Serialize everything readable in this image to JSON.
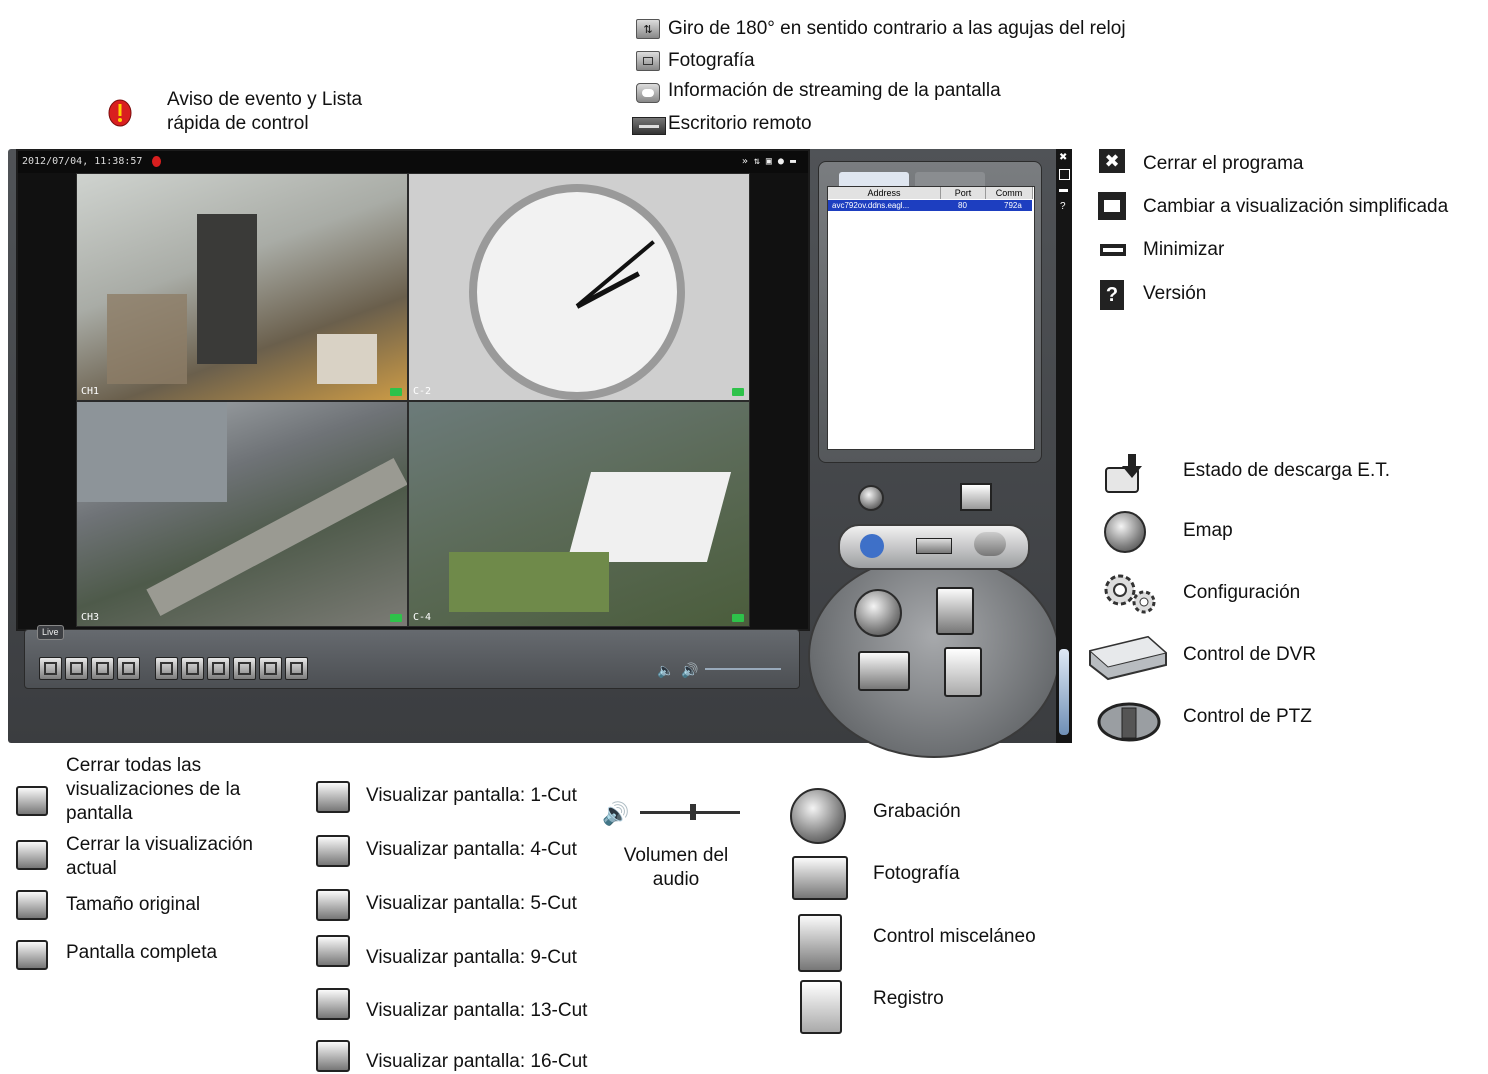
{
  "top_callouts": {
    "event_alert": "Aviso de evento y Lista rápida de control",
    "rotate": "Giro de 180° en sentido contrario a las agujas del reloj",
    "snapshot": "Fotografía",
    "streaming_info": "Información de streaming de la pantalla",
    "remote_desktop": "Escritorio remoto"
  },
  "right_callouts": {
    "close_program": "Cerrar el programa",
    "simple_view": "Cambiar a visualización simplificada",
    "minimize": "Minimizar",
    "version": "Versión",
    "download_status": "Estado de descarga E.T.",
    "emap": "Emap",
    "config": "Configuración",
    "dvr_control": "Control de DVR",
    "ptz_control": "Control de PTZ"
  },
  "app": {
    "timestamp": "2012/07/04, 11:38:57",
    "channels": [
      "CH1",
      "C-2",
      "CH3",
      "C-4"
    ],
    "live_tag": "Live",
    "device_list": {
      "columns": [
        "Address",
        "Port",
        "Comm"
      ],
      "rows": [
        [
          "avc792ov.ddns.eagl...",
          "80",
          "792a"
        ]
      ]
    },
    "colors": {
      "window": "#4a4d50",
      "video_bg": "#111111",
      "selected_row": "#1d3ec0",
      "rec_indicator": "#2ec24a",
      "alert": "#d91f1f"
    }
  },
  "bottom_left": [
    "Cerrar todas las visualizaciones de la pantalla",
    "Cerrar la visualización actual",
    "Tamaño original",
    "Pantalla completa"
  ],
  "bottom_mid": [
    "Visualizar pantalla: 1-Cut",
    "Visualizar pantalla: 4-Cut",
    "Visualizar pantalla: 5-Cut",
    "Visualizar pantalla: 9-Cut",
    "Visualizar pantalla: 13-Cut",
    "Visualizar pantalla: 16-Cut"
  ],
  "volume": {
    "label_line1": "Volumen del",
    "label_line2": "audio"
  },
  "bottom_right": {
    "record": "Grabación",
    "snapshot": "Fotografía",
    "misc": "Control misceláneo",
    "log": "Registro"
  }
}
